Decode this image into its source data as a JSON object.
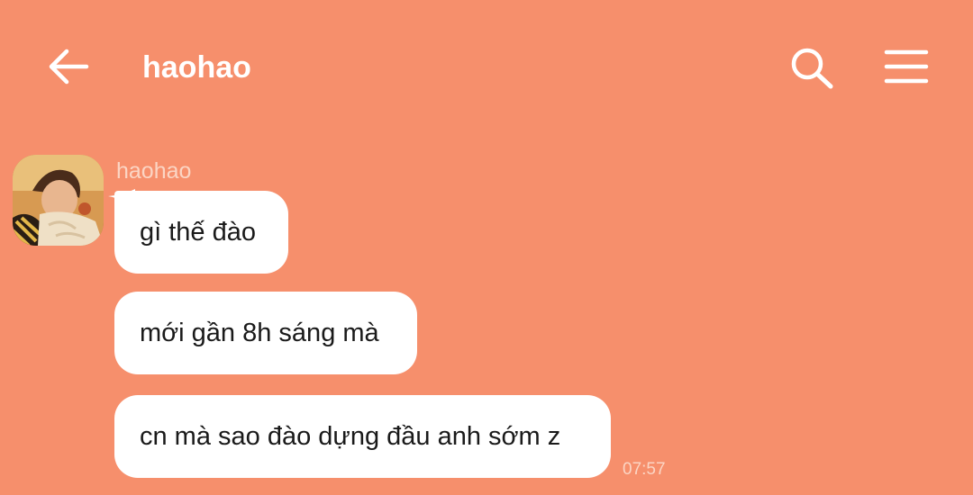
{
  "header": {
    "title": "haohao"
  },
  "icons": {
    "back": "arrow-left-icon",
    "search": "search-icon",
    "menu": "hamburger-menu-icon"
  },
  "colors": {
    "background": "#f68f6c",
    "bubble": "#ffffff",
    "header_text": "#ffffff",
    "muted_text": "#fbd5c4"
  },
  "conversation": {
    "sender_name": "haohao",
    "messages": [
      {
        "text": "gì thế đào"
      },
      {
        "text": "mới gần 8h sáng mà"
      },
      {
        "text": "cn mà sao đào dựng đầu anh sớm z"
      }
    ],
    "last_timestamp": "07:57"
  }
}
